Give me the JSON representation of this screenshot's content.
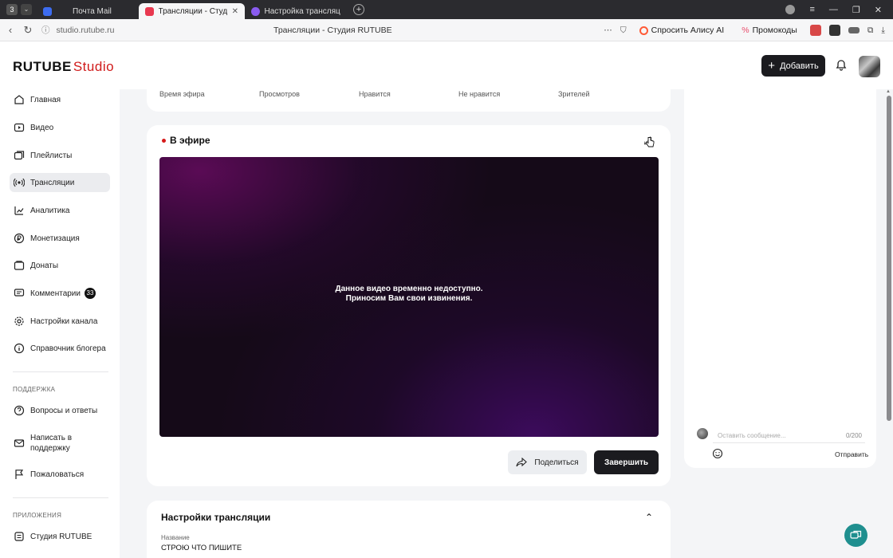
{
  "browser": {
    "badge": "3",
    "tabs": [
      {
        "label": "Почта Mail",
        "color": "#3d6cf0",
        "active": false
      },
      {
        "label": "Трансляции - Студия R",
        "color": "#e8384f",
        "active": true
      },
      {
        "label": "Настройка трансляции R",
        "color": "#8a5cf0",
        "active": false
      }
    ],
    "url": "studio.rutube.ru",
    "page_title": "Трансляции - Студия RUTUBE",
    "ask_alice": "Спросить Алису AI",
    "promocodes": "Промокоды"
  },
  "header": {
    "logo_main": "RUTUBE",
    "logo_sub": "Studio",
    "add_button": "Добавить"
  },
  "sidebar": {
    "items": [
      {
        "label": "Главная",
        "icon": "home-icon"
      },
      {
        "label": "Видео",
        "icon": "video-icon"
      },
      {
        "label": "Плейлисты",
        "icon": "playlist-icon"
      },
      {
        "label": "Трансляции",
        "icon": "broadcast-icon"
      },
      {
        "label": "Аналитика",
        "icon": "analytics-icon"
      },
      {
        "label": "Монетизация",
        "icon": "ruble-icon"
      },
      {
        "label": "Донаты",
        "icon": "donate-icon"
      },
      {
        "label": "Комментарии",
        "icon": "comment-icon",
        "badge": "33"
      },
      {
        "label": "Настройки канала",
        "icon": "gear-icon"
      },
      {
        "label": "Справочник блогера",
        "icon": "info-icon"
      }
    ],
    "support_head": "ПОДДЕРЖКА",
    "support_items": [
      {
        "label": "Вопросы и ответы",
        "icon": "faq-icon"
      },
      {
        "label": "Написать в поддержку",
        "icon": "mail-icon"
      },
      {
        "label": "Пожаловаться",
        "icon": "flag-icon"
      }
    ],
    "apps_head": "ПРИЛОЖЕНИЯ",
    "apps_items": [
      {
        "label": "Студия RUTUBE",
        "icon": "studio-app-icon"
      }
    ]
  },
  "stats": {
    "labels": [
      "Время эфира",
      "Просмотров",
      "Нравится",
      "Не нравится",
      "Зрителей"
    ]
  },
  "live": {
    "title": "В эфире",
    "message_line1": "Данное видео временно недоступно.",
    "message_line2": "Приносим Вам свои извинения.",
    "share_button": "Поделиться",
    "finish_button": "Завершить"
  },
  "settings": {
    "title": "Настройки трансляции",
    "name_label": "Название",
    "name_value": "СТРОЮ ЧТО ПИШИТЕ"
  },
  "chat": {
    "placeholder": "Оставить сообщение...",
    "counter": "0/200",
    "send_button": "Отправить"
  },
  "colors": {
    "accent_red": "#d61a1a",
    "dark_button": "#1b1b1f",
    "help_fab": "#1f8f8f"
  }
}
